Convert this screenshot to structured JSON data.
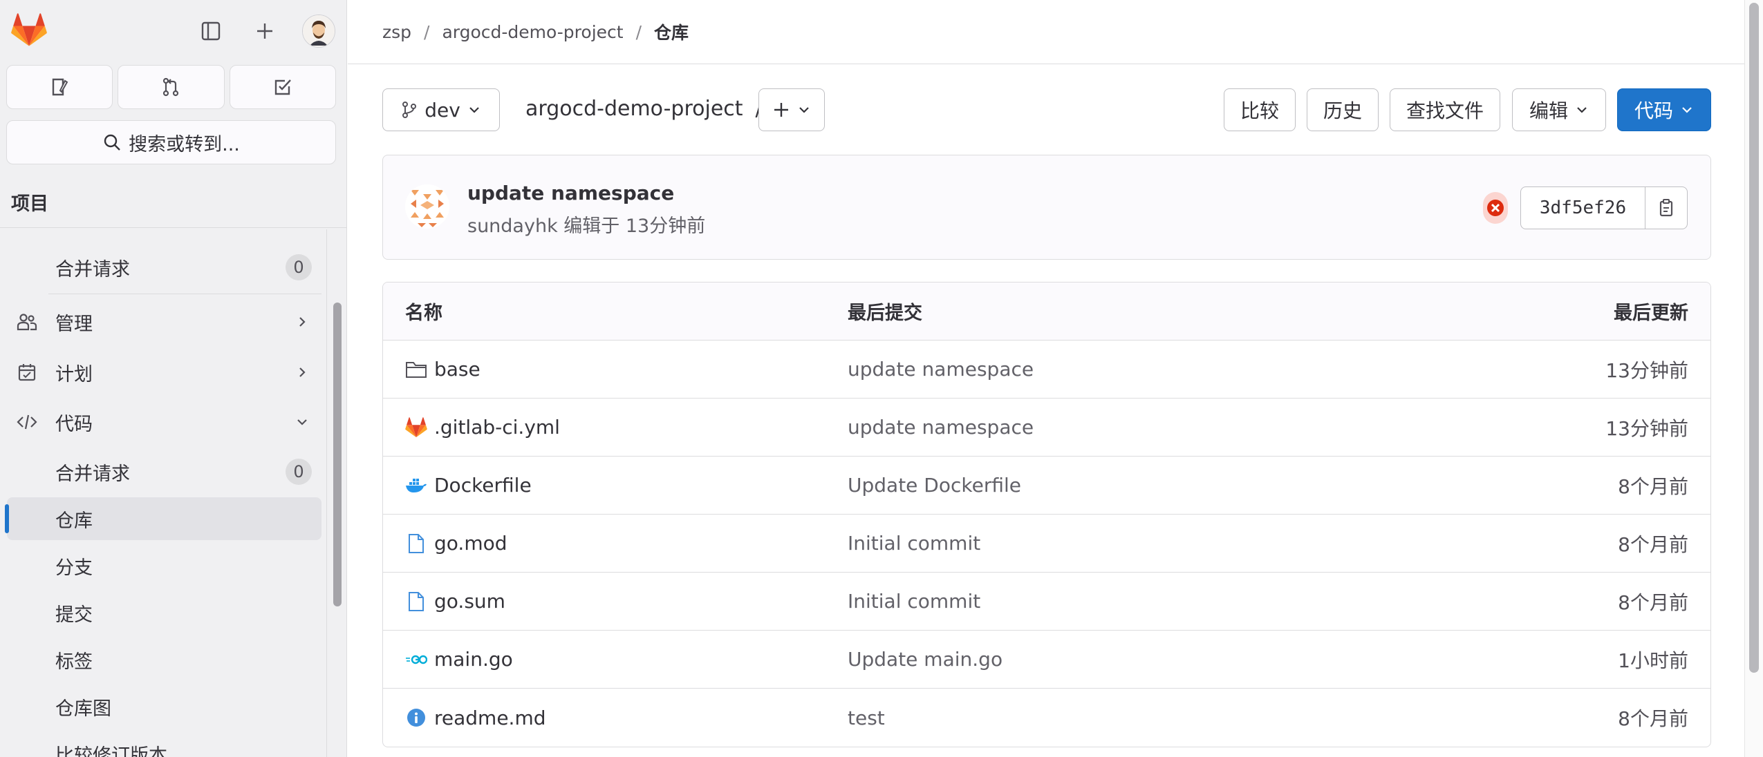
{
  "sidebar": {
    "search_label": "搜索或转到...",
    "section_title": "项目",
    "items": [
      {
        "label": "合并请求",
        "badge": "0"
      },
      {
        "label": "管理"
      },
      {
        "label": "计划"
      },
      {
        "label": "代码"
      },
      {
        "label": "合并请求",
        "badge": "0"
      },
      {
        "label": "仓库"
      },
      {
        "label": "分支"
      },
      {
        "label": "提交"
      },
      {
        "label": "标签"
      },
      {
        "label": "仓库图"
      },
      {
        "label": "比较修订版本"
      }
    ]
  },
  "breadcrumb": [
    "zsp",
    "argocd-demo-project",
    "仓库"
  ],
  "toolbar": {
    "branch": "dev",
    "project": "argocd-demo-project",
    "path_sep": "/",
    "compare": "比较",
    "history": "历史",
    "find_file": "查找文件",
    "edit": "编辑",
    "code": "代码"
  },
  "commit": {
    "title": "update namespace",
    "meta": "sundayhk 编辑于 13分钟前",
    "sha": "3df5ef26"
  },
  "table": {
    "headers": {
      "name": "名称",
      "last_commit": "最后提交",
      "last_update": "最后更新"
    },
    "rows": [
      {
        "name": "base",
        "icon": "folder-icon",
        "commit": "update namespace",
        "date": "13分钟前"
      },
      {
        "name": ".gitlab-ci.yml",
        "icon": "gitlab-ci-icon",
        "commit": "update namespace",
        "date": "13分钟前"
      },
      {
        "name": "Dockerfile",
        "icon": "docker-icon",
        "commit": "Update Dockerfile",
        "date": "8个月前"
      },
      {
        "name": "go.mod",
        "icon": "file-icon",
        "commit": "Initial commit",
        "date": "8个月前"
      },
      {
        "name": "go.sum",
        "icon": "file-icon",
        "commit": "Initial commit",
        "date": "8个月前"
      },
      {
        "name": "main.go",
        "icon": "go-icon",
        "commit": "Update main.go",
        "date": "1小时前"
      },
      {
        "name": "readme.md",
        "icon": "info-icon",
        "commit": "test",
        "date": "8个月前"
      }
    ]
  },
  "colors": {
    "accent": "#1f75cb",
    "gitlab_orange": "#e24329",
    "pipeline_failed": "#dd2b0e"
  }
}
